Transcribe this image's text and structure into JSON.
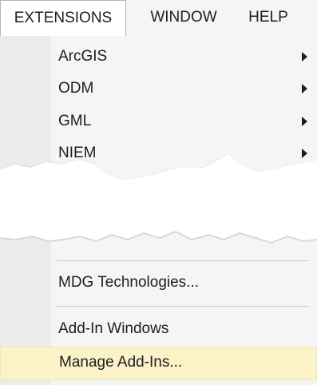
{
  "menubar": {
    "extensions": "EXTENSIONS",
    "window": "WINDOW",
    "help": "HELP"
  },
  "menu": {
    "items": [
      {
        "label": "ArcGIS",
        "has_submenu": true
      },
      {
        "label": "ODM",
        "has_submenu": true
      },
      {
        "label": "GML",
        "has_submenu": true
      },
      {
        "label": "NIEM",
        "has_submenu": true
      }
    ],
    "mdg_technologies": "MDG Technologies...",
    "add_in_windows": "Add-In Windows",
    "manage_add_ins": "Manage Add-Ins..."
  },
  "colors": {
    "highlight": "#fcf2c8",
    "menu_bg": "#f5f5f5",
    "text": "#1e1e1e"
  }
}
